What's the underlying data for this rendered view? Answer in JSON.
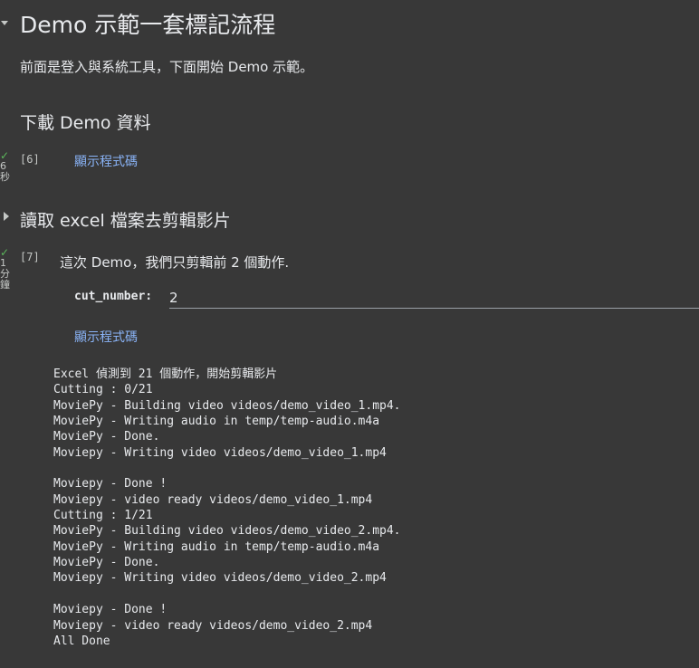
{
  "section_title": "Demo 示範一套標記流程",
  "intro_text": "前面是登入與系統工具，下面開始 Demo 示範。",
  "download_heading": "下載 Demo 資料",
  "cell6": {
    "status_time": "6\n秒",
    "exec_count": "[6]",
    "show_code": "顯示程式碼"
  },
  "excel_heading": "讀取 excel 檔案去剪輯影片",
  "cell7": {
    "status_time": "1\n分\n鐘",
    "exec_count": "[7]",
    "description": "這次 Demo，我們只剪輯前 2 個動作.",
    "param_label": "cut_number:",
    "param_value": "2",
    "show_code": "顯示程式碼",
    "output_lines": [
      "Excel 偵測到 21 個動作，開始剪輯影片",
      "Cutting : 0/21",
      "MoviePy - Building video videos/demo_video_1.mp4.",
      "MoviePy - Writing audio in temp/temp-audio.m4a",
      "MoviePy - Done.",
      "Moviepy - Writing video videos/demo_video_1.mp4",
      "",
      "Moviepy - Done !",
      "Moviepy - video ready videos/demo_video_1.mp4",
      "Cutting : 1/21",
      "MoviePy - Building video videos/demo_video_2.mp4.",
      "MoviePy - Writing audio in temp/temp-audio.m4a",
      "MoviePy - Done.",
      "Moviepy - Writing video videos/demo_video_2.mp4",
      "",
      "Moviepy - Done !",
      "Moviepy - video ready videos/demo_video_2.mp4",
      "All Done"
    ]
  },
  "colors": {
    "background": "#383838",
    "text": "#e8eaed",
    "link": "#8ab4f8",
    "success_tick": "#5cb85c"
  },
  "icons": {
    "expanded_caret": "caret-down-icon",
    "collapsed_caret": "caret-right-icon",
    "success": "check-icon"
  }
}
